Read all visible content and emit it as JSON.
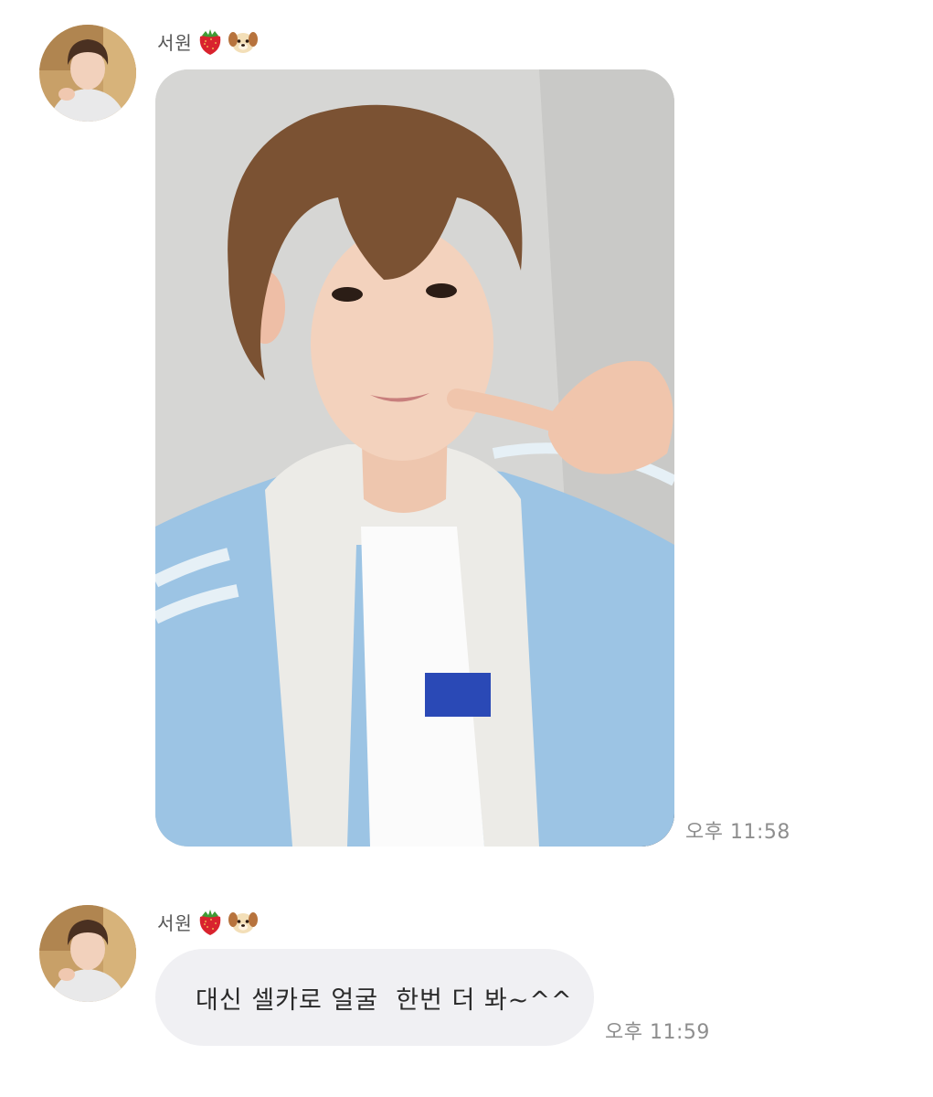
{
  "messages": [
    {
      "sender": {
        "name": "서원",
        "emojis": [
          "strawberry-icon",
          "dog-face-icon"
        ]
      },
      "type": "photo",
      "photo_description_icon": "selfie-photo",
      "time": "오후 11:58"
    },
    {
      "sender": {
        "name": "서원",
        "emojis": [
          "strawberry-icon",
          "dog-face-icon"
        ]
      },
      "type": "text",
      "text": "대신 셀카로 얼굴  한번 더 봐~^^",
      "time": "오후 11:59"
    }
  ],
  "colors": {
    "background": "#ffffff",
    "bubble": "#f0f0f3",
    "timestamp": "#8e8e8e",
    "sender_name": "#555555"
  }
}
